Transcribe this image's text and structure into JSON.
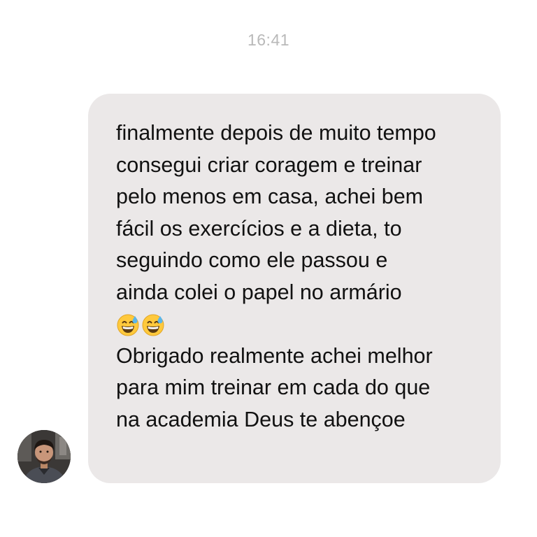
{
  "conversation": {
    "timestamp": "16:41",
    "message": {
      "lines_before_emoji": [
        "finalmente depois de muito tempo",
        "consegui criar coragem e treinar",
        "pelo menos em casa, achei bem",
        "fácil os exercícios e a dieta, to",
        "seguindo como ele passou e",
        "ainda colei o papel no armário"
      ],
      "emojis": [
        "grinning-face-with-sweat",
        "grinning-face-with-sweat"
      ],
      "lines_after_emoji": [
        "Obrigado realmente achei melhor",
        "para mim treinar em cada do que",
        "na academia Deus te abençoe"
      ]
    },
    "sender": {
      "avatar_icon": "user-photo"
    }
  },
  "colors": {
    "bubble_background": "#ebe8e8",
    "timestamp_text": "#b9b9b9",
    "message_text": "#111111"
  }
}
